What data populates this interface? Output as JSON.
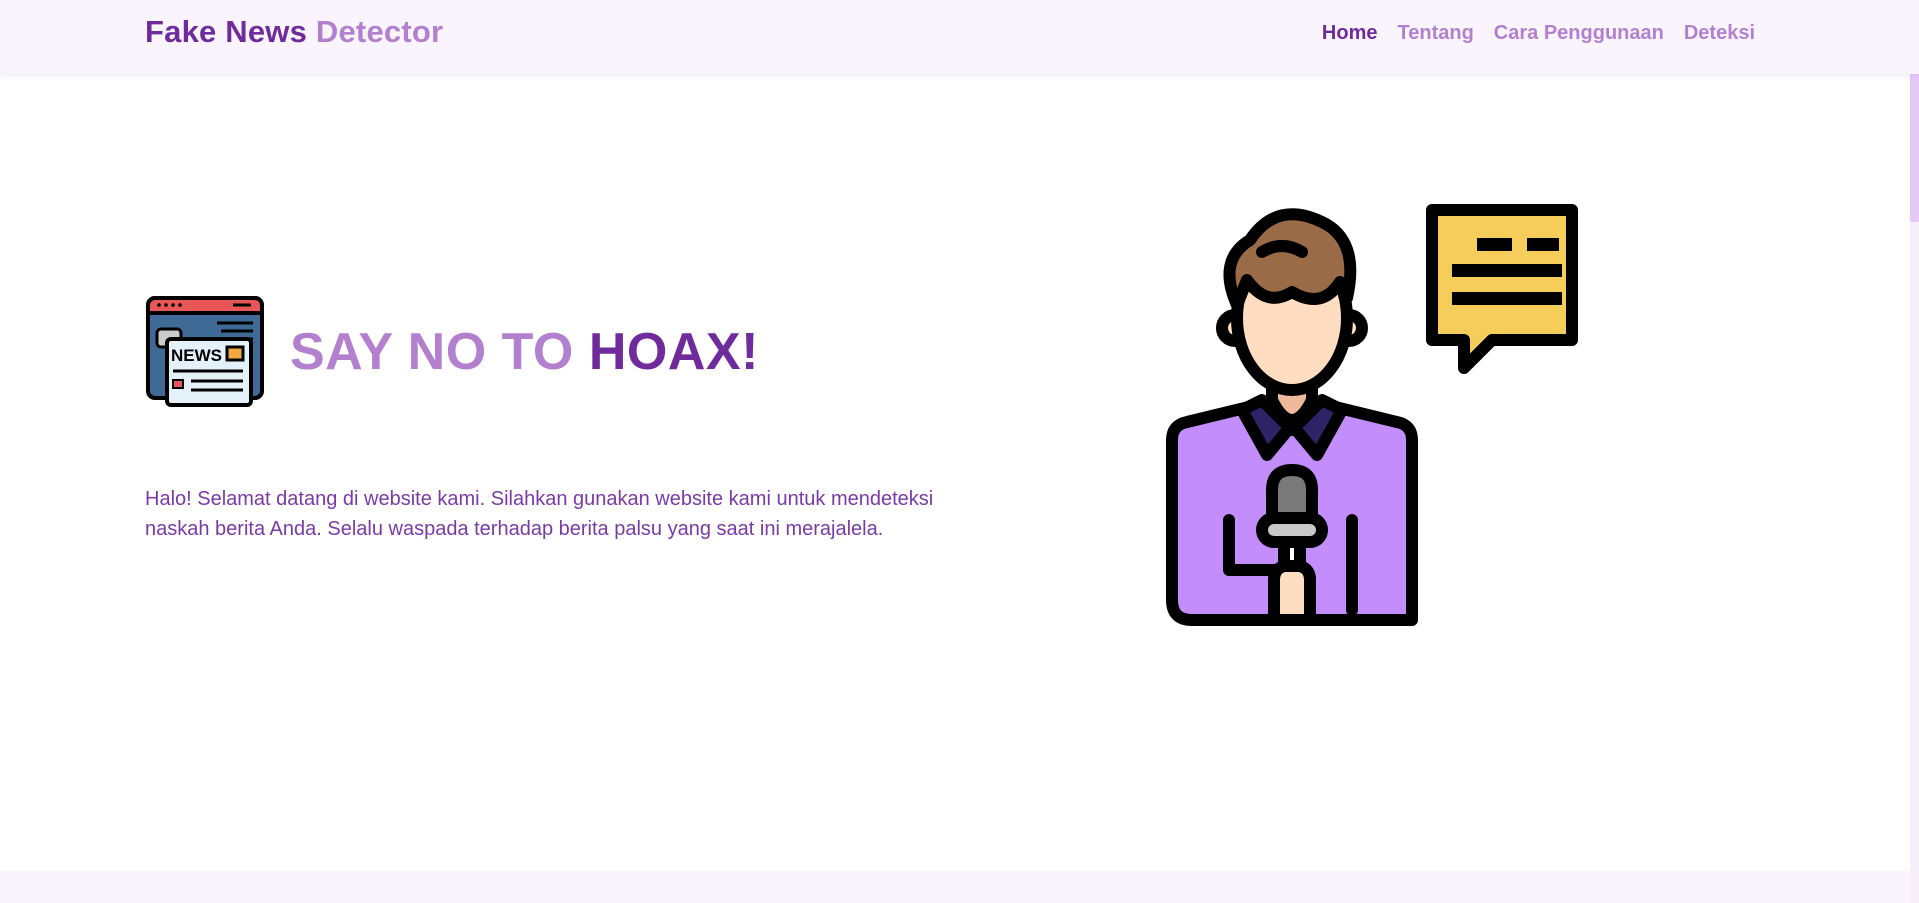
{
  "brand": {
    "part1": "Fake News",
    "part2": "Detector"
  },
  "nav": {
    "items": [
      {
        "label": "Home",
        "active": true
      },
      {
        "label": "Tentang",
        "active": false
      },
      {
        "label": "Cara Penggunaan",
        "active": false
      },
      {
        "label": "Deteksi",
        "active": false
      }
    ]
  },
  "hero": {
    "headline_light": "SAY NO TO",
    "headline_dark": "HOAX!",
    "intro": "Halo! Selamat datang di website kami. Silahkan gunakan website kami untuk mendeteksi naskah berita Anda. Selalu waspada terhadap berita palsu yang saat ini merajalela.",
    "icon_name": "news-icon",
    "news_icon_text": "NEWS",
    "illustration_name": "news-reporter-illustration"
  },
  "colors": {
    "brand_dark": "#6f2a9c",
    "brand_light": "#b380cf",
    "navbar_bg": "#faf5fd",
    "reporter_shirt": "#c38efb",
    "speech_bubble": "#f5cd5b"
  }
}
